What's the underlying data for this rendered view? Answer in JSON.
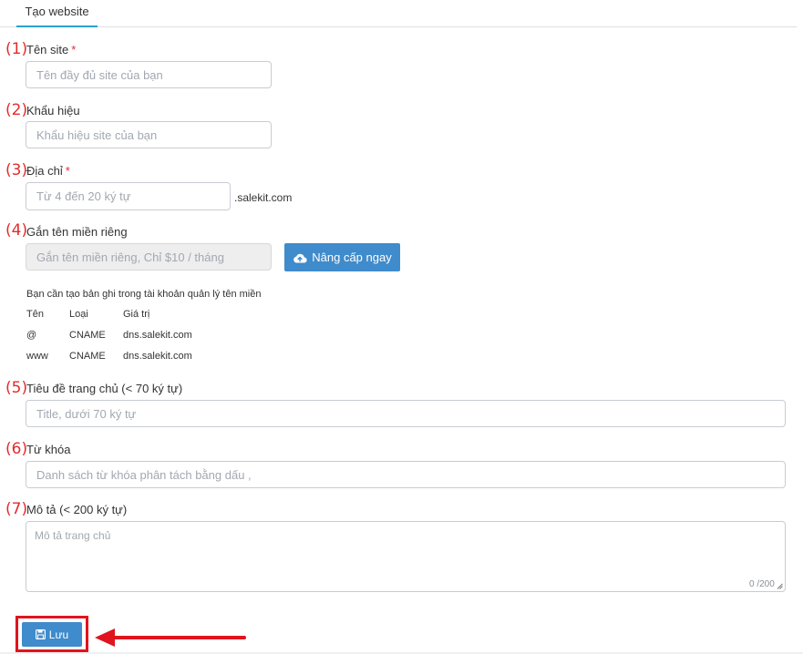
{
  "tab": {
    "label": "Tạo website"
  },
  "fields": {
    "site_name": {
      "num": "(1)",
      "label": "Tên site",
      "required": "*",
      "placeholder": "Tên đầy đủ site của bạn"
    },
    "slogan": {
      "num": "(2)",
      "label": "Khẩu hiệu",
      "placeholder": "Khẩu hiệu site của bạn"
    },
    "address": {
      "num": "(3)",
      "label": "Địa chỉ",
      "required": "*",
      "placeholder": "Từ 4 đến 20 ký tự",
      "suffix": ".salekit.com"
    },
    "domain": {
      "num": "(4)",
      "label": "Gắn tên miền riêng",
      "placeholder": "Gắn tên miền riêng, Chỉ $10 / tháng",
      "upgrade_label": "Nâng cấp ngay"
    },
    "home_title": {
      "num": "(5)",
      "label": "Tiêu đề trang chủ (< 70 ký tự)",
      "placeholder": "Title, dưới 70 ký tự"
    },
    "keywords": {
      "num": "(6)",
      "label": "Từ khóa",
      "placeholder": "Danh sách từ khóa phân tách bằng dấu ,"
    },
    "description": {
      "num": "(7)",
      "label": "Mô tả (< 200 ký tự)",
      "placeholder": "Mô tả trang chủ",
      "counter": "0 /200"
    }
  },
  "dns": {
    "note": "Bạn cần tạo bản ghi trong tài khoản quản lý tên miền",
    "headers": [
      "Tên",
      "Loại",
      "Giá trị"
    ],
    "rows": [
      [
        "@",
        "CNAME",
        "dns.salekit.com"
      ],
      [
        "www",
        "CNAME",
        "dns.salekit.com"
      ]
    ]
  },
  "save": {
    "label": "Lưu"
  },
  "icons": {
    "upgrade": "cloud-upload-icon",
    "save": "floppy-disk-icon"
  },
  "colors": {
    "accent": "#3f8bcb",
    "annotation": "#e0141e",
    "required": "#e52b2b"
  }
}
